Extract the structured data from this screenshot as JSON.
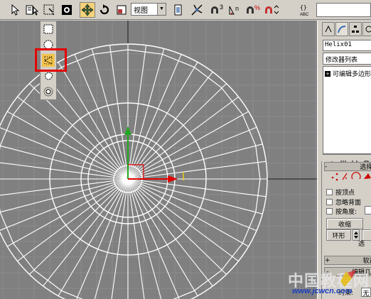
{
  "toolbar": {
    "view_combo_value": "视图",
    "snap_label": "3",
    "angle_snap_label": "n",
    "percent_snap_label": "%",
    "mirror_label": "ABC",
    "tools": [
      "select-object",
      "select-by-name",
      "region-select",
      "select-filter",
      "move",
      "rotate",
      "scale",
      "view-combo",
      "pivot",
      "manipulate",
      "snap-3d",
      "angle-snap",
      "percent-snap",
      "spinner-snap",
      "named-selection"
    ],
    "named_selection_value": ""
  },
  "flyout": {
    "items": [
      "rectangle-region",
      "circle-region",
      "fence-region",
      "lasso-region",
      "paint-region"
    ],
    "active_index": 2
  },
  "viewport": {
    "object": "helix-mesh",
    "wire_color": "#ffffff",
    "background": "#808080",
    "highlight_color": "#e30000"
  },
  "command_panel": {
    "object_name": "Helix01",
    "modifier_list_label": "修改器列表",
    "stack_item_label": "可编辑多边形",
    "selection_rollout": {
      "sign": "-",
      "title": "选择",
      "checkboxes": [
        {
          "label": "按顶点",
          "checked": false
        },
        {
          "label": "忽略背面",
          "checked": false
        },
        {
          "label": "按角度:",
          "checked": false
        }
      ],
      "shrink_label": "收缩",
      "ring_label": "环形",
      "selection_info": "选"
    },
    "soft_selection_rollout": {
      "sign": "+",
      "title": "软选"
    },
    "geometry_rollout": {
      "sign": "-",
      "title": "编辑几"
    },
    "constraint_label": "约束:",
    "constraint_value": "无"
  },
  "watermark": {
    "cn_text": "中国教程网",
    "url": "www.jcwcn.com"
  }
}
